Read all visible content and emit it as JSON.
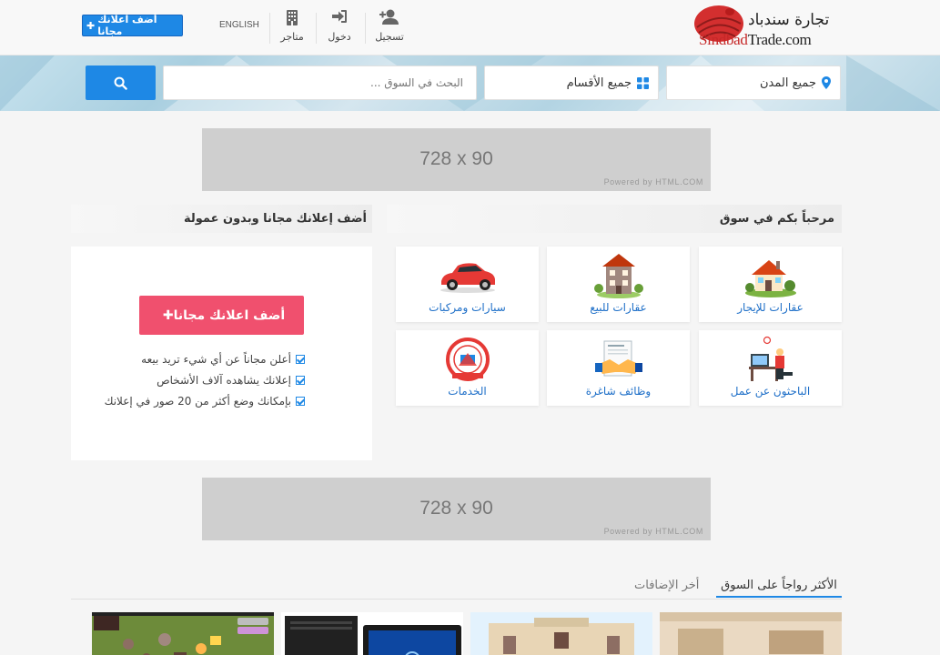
{
  "header": {
    "add_free_label": "أضف اعلانك مجانا",
    "language_label": "ENGLISH",
    "nav": [
      {
        "label": "متاجر",
        "icon": "building-icon"
      },
      {
        "label": "دخول",
        "icon": "login-icon"
      },
      {
        "label": "تسجيل",
        "icon": "add-user-icon"
      }
    ],
    "logo_arabic": "تجارة سندباد",
    "logo_english_prefix": "Sindbad",
    "logo_english_suffix": "Trade.com"
  },
  "search": {
    "placeholder": "البحث في السوق ...",
    "categories_label": "جميع الأقسام",
    "cities_label": "جميع المدن"
  },
  "ads": [
    {
      "size": "728 x 90",
      "powered": "Powered by HTML.COM"
    },
    {
      "size": "728 x 90",
      "powered": "Powered by HTML.COM"
    }
  ],
  "welcome": {
    "title": "مرحباً بكم في سوق",
    "categories": [
      {
        "label": "عقارات للإيجار",
        "icon": "house-rent-icon"
      },
      {
        "label": "عقارات للبيع",
        "icon": "building-sale-icon"
      },
      {
        "label": "سيارات ومركبات",
        "icon": "car-icon"
      },
      {
        "label": "الباحثون عن عمل",
        "icon": "job-seeker-icon"
      },
      {
        "label": "وظائف شاغرة",
        "icon": "handshake-icon"
      },
      {
        "label": "الخدمات",
        "icon": "services-icon"
      }
    ]
  },
  "free_ad": {
    "title": "أضف إعلانك مجانا وبدون عمولة",
    "button_label": "أضف اعلانك مجانا",
    "features": [
      "أعلن مجاناً عن أي شيء تريد بيعه",
      "إعلانك يشاهده آلاف الأشخاص",
      "بإمكانك وضع أكثر من 20 صور في إعلانك"
    ]
  },
  "tabs": [
    {
      "label": "الأكثر رواجاً على السوق",
      "active": true
    },
    {
      "label": "أخر الإضافات",
      "active": false
    }
  ],
  "colors": {
    "primary": "#1e88e5",
    "accent_pink": "#f0506e",
    "link_blue": "#1e6fc8"
  }
}
